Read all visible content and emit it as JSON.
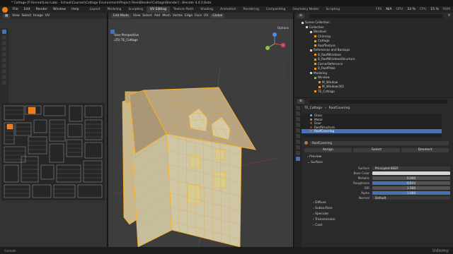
{
  "titlebar": {
    "title": "* Cottage [F:\\Unreal\\Lexi Labs - School\\Courses\\Cottage Environment\\Project Files\\Blender\\Cottage\\Blender] - Blender 4.4.0 Beta"
  },
  "menu": [
    "File",
    "Edit",
    "Render",
    "Window",
    "Help"
  ],
  "workspace_tabs": [
    {
      "label": "Layout"
    },
    {
      "label": "Modeling"
    },
    {
      "label": "Sculpting"
    },
    {
      "label": "UV Editing"
    },
    {
      "label": "Texture Paint"
    },
    {
      "label": "Shading"
    },
    {
      "label": "Animation"
    },
    {
      "label": "Rendering"
    },
    {
      "label": "Compositing"
    },
    {
      "label": "Geometry Nodes"
    },
    {
      "label": "Scripting"
    }
  ],
  "stats": {
    "fps_label": "FPS",
    "fps": "N/A",
    "gpu_label": "GPU",
    "gpu": "33 %",
    "cpu_label": "CPU",
    "cpu": "15 %",
    "ram_label": "RAM"
  },
  "uv_editor": {
    "header_items": [
      "View",
      "Select",
      "Image",
      "UV"
    ]
  },
  "viewport": {
    "mode": "Edit Mode",
    "menus": [
      "View",
      "Select",
      "Add",
      "Mesh",
      "Vertex",
      "Edge",
      "Face",
      "UV"
    ],
    "transform": "Global",
    "overlay_line1": "User Perspective",
    "overlay_line2": "(25) TE_Cottage",
    "options": "Options"
  },
  "outliner": {
    "items": [
      {
        "label": "Scene Collection",
        "indent": 0,
        "color": "w"
      },
      {
        "label": "Collection",
        "indent": 1,
        "color": "w"
      },
      {
        "label": "Blockout",
        "indent": 2,
        "color": "w"
      },
      {
        "label": "Chimney",
        "indent": 3,
        "color": "o"
      },
      {
        "label": "Cottage",
        "indent": 3,
        "color": "o"
      },
      {
        "label": "RoofTexture",
        "indent": 3,
        "color": "o"
      },
      {
        "label": "References and Backups",
        "indent": 2,
        "color": "w"
      },
      {
        "label": "B_RoofWindows",
        "indent": 3,
        "color": "o"
      },
      {
        "label": "B_RoofWindowsStructure",
        "indent": 3,
        "color": "o"
      },
      {
        "label": "CornerReference",
        "indent": 3,
        "color": "o"
      },
      {
        "label": "B_RoofPlate",
        "indent": 3,
        "color": "o"
      },
      {
        "label": "Modeling",
        "indent": 2,
        "color": "w"
      },
      {
        "label": "Window",
        "indent": 3,
        "color": "g"
      },
      {
        "label": "M_Window",
        "indent": 4,
        "color": "o"
      },
      {
        "label": "M_Window.001",
        "indent": 4,
        "color": "o"
      },
      {
        "label": "TE_Cottage",
        "indent": 3,
        "color": "o"
      }
    ]
  },
  "properties": {
    "breadcrumb_object": "TE_Cottage",
    "breadcrumb_material": "RoofCovering",
    "materials": [
      {
        "label": "Glass",
        "selected": false,
        "color": "#8fb2c9"
      },
      {
        "label": "Metal",
        "selected": false,
        "color": "#9a9a9a"
      },
      {
        "label": "Door",
        "selected": false,
        "color": "#7a5a3c"
      },
      {
        "label": "RoofStructure",
        "selected": false,
        "color": "#6b4a35"
      },
      {
        "label": "RoofCovering",
        "selected": true,
        "color": "#b57a4a"
      }
    ],
    "material_name": "RoofCovering",
    "assign": "Assign",
    "select": "Select",
    "deselect": "Deselect",
    "preview": "Preview",
    "surface_section": "Surface",
    "surface_label": "Surface",
    "surface_value": "Principled BSDF",
    "base_color_label": "Base Color",
    "params": [
      {
        "label": "Metallic",
        "value": "0.000",
        "fill": 0.0
      },
      {
        "label": "Roughness",
        "value": "0.500",
        "fill": 0.5
      },
      {
        "label": "IOR",
        "value": "1.500",
        "fill": 0.0
      },
      {
        "label": "Alpha",
        "value": "1.000",
        "fill": 1.0
      }
    ],
    "normal_label": "Normal",
    "normal_value": "Default",
    "subsections": [
      "Diffuse",
      "Subsurface",
      "Specular",
      "Transmission",
      "Coat"
    ]
  },
  "statusbar": {
    "left": "Console",
    "right": "Udemy"
  }
}
